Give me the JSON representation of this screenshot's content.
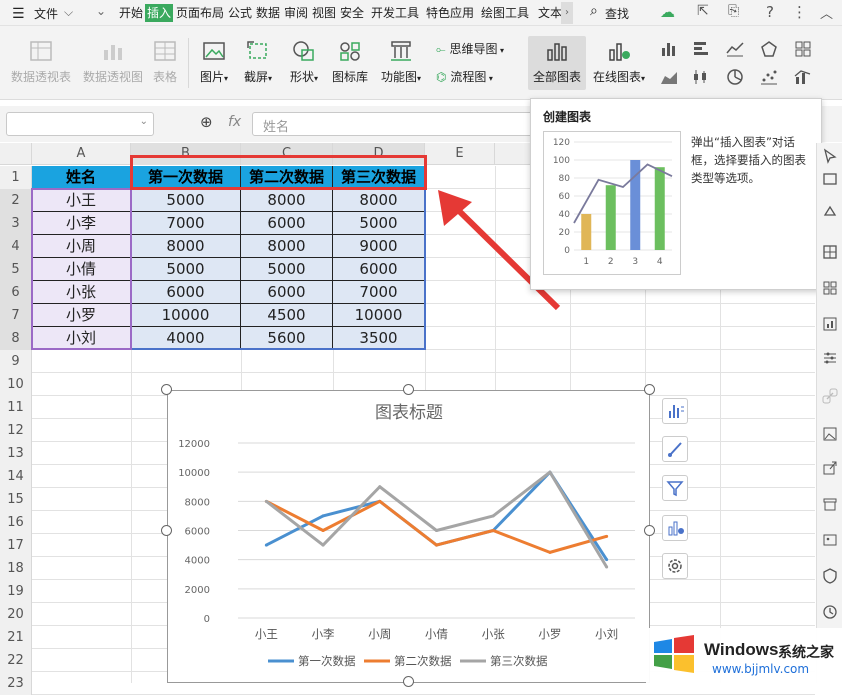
{
  "menubar": {
    "file_label": "文件",
    "tabs": [
      "开始",
      "插入",
      "页面布局",
      "公式",
      "数据",
      "审阅",
      "视图",
      "安全",
      "开发工具",
      "特色应用",
      "绘图工具",
      "文本"
    ],
    "active_tab": "插入",
    "search_label": "查找"
  },
  "ribbon": {
    "pivot_table": "数据透视表",
    "pivot_chart": "数据透视图",
    "table": "表格",
    "picture": "图片",
    "screenshot": "截屏",
    "shape": "形状",
    "icon_library": "图标库",
    "function_chart": "功能图",
    "mind_map": "思维导图",
    "flowchart": "流程图",
    "all_charts": "全部图表",
    "online_charts": "在线图表"
  },
  "formula_bar": {
    "fx_label": "fx",
    "content": "姓名"
  },
  "grid": {
    "columns": [
      "A",
      "B",
      "C",
      "D",
      "E"
    ],
    "rows": [
      "1",
      "2",
      "3",
      "4",
      "5",
      "6",
      "7",
      "8",
      "9",
      "10",
      "11",
      "12",
      "13",
      "14",
      "15",
      "16",
      "17",
      "18",
      "19",
      "20",
      "21",
      "22",
      "23",
      "24"
    ],
    "headers": [
      "姓名",
      "第一次数据",
      "第二次数据",
      "第三次数据"
    ],
    "data": [
      [
        "小王",
        "5000",
        "8000",
        "8000"
      ],
      [
        "小李",
        "7000",
        "6000",
        "5000"
      ],
      [
        "小周",
        "8000",
        "8000",
        "9000"
      ],
      [
        "小倩",
        "5000",
        "5000",
        "6000"
      ],
      [
        "小张",
        "6000",
        "6000",
        "7000"
      ],
      [
        "小罗",
        "10000",
        "4500",
        "10000"
      ],
      [
        "小刘",
        "4000",
        "5600",
        "3500"
      ]
    ]
  },
  "tooltip": {
    "title": "创建图表",
    "description": "弹出“插入图表”对话框，选择要插入的图表类型等选项。",
    "preview_y_ticks": [
      "120",
      "100",
      "80",
      "60",
      "40",
      "20",
      "0"
    ],
    "preview_x_ticks": [
      "1",
      "2",
      "3",
      "4"
    ],
    "preview_bar_colors": [
      "#e0b657",
      "#6cbf5f",
      "#6a8fd8",
      "#6cbf5f"
    ]
  },
  "chart_data": {
    "type": "line",
    "title": "图表标题",
    "categories": [
      "小王",
      "小李",
      "小周",
      "小倩",
      "小张",
      "小罗",
      "小刘"
    ],
    "y_ticks": [
      "12000",
      "10000",
      "8000",
      "6000",
      "4000",
      "2000",
      "0"
    ],
    "ylim": [
      0,
      12000
    ],
    "grid": true,
    "legend_position": "bottom",
    "series": [
      {
        "name": "第一次数据",
        "color": "#4a90d0",
        "values": [
          5000,
          7000,
          8000,
          5000,
          6000,
          10000,
          4000
        ]
      },
      {
        "name": "第二次数据",
        "color": "#ed7d31",
        "values": [
          8000,
          6000,
          8000,
          5000,
          6000,
          4500,
          5600
        ]
      },
      {
        "name": "第三次数据",
        "color": "#a5a5a5",
        "values": [
          8000,
          5000,
          9000,
          6000,
          7000,
          10000,
          3500
        ]
      }
    ]
  },
  "watermark": {
    "brand": "Windows",
    "brand_cn": "系统之家",
    "url": "www.bjjmlv.com"
  },
  "colors": {
    "accent_green": "#3aa95e",
    "header_fill": "#1aa3e0",
    "highlight_red": "#e53935"
  }
}
